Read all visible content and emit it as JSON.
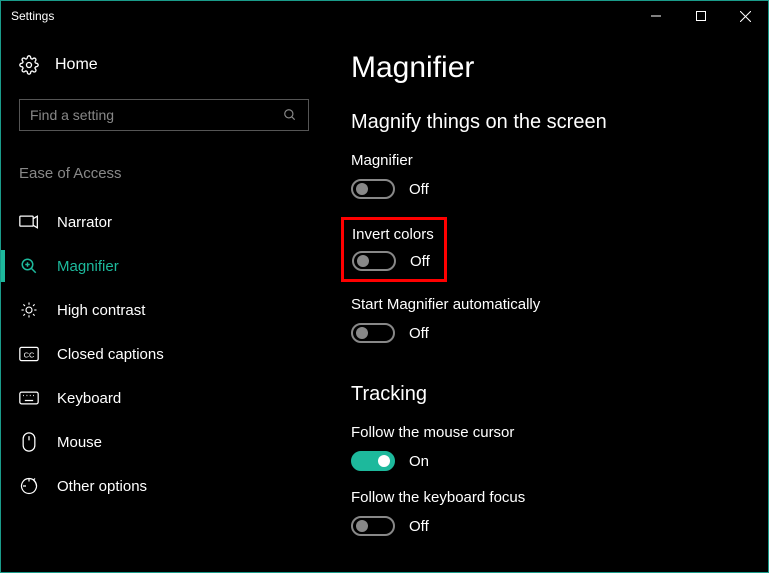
{
  "window": {
    "title": "Settings"
  },
  "sidebar": {
    "home_label": "Home",
    "search_placeholder": "Find a setting",
    "category": "Ease of Access",
    "items": [
      {
        "label": "Narrator"
      },
      {
        "label": "Magnifier"
      },
      {
        "label": "High contrast"
      },
      {
        "label": "Closed captions"
      },
      {
        "label": "Keyboard"
      },
      {
        "label": "Mouse"
      },
      {
        "label": "Other options"
      }
    ]
  },
  "main": {
    "title": "Magnifier",
    "section1": {
      "heading": "Magnify things on the screen",
      "magnifier": {
        "label": "Magnifier",
        "status": "Off"
      },
      "invert": {
        "label": "Invert colors",
        "status": "Off"
      },
      "autostart": {
        "label": "Start Magnifier automatically",
        "status": "Off"
      }
    },
    "section2": {
      "heading": "Tracking",
      "mouse": {
        "label": "Follow the mouse cursor",
        "status": "On"
      },
      "keyboard": {
        "label": "Follow the keyboard focus",
        "status": "Off"
      }
    }
  },
  "colors": {
    "accent": "#1db99c",
    "highlight": "#ff0000"
  }
}
